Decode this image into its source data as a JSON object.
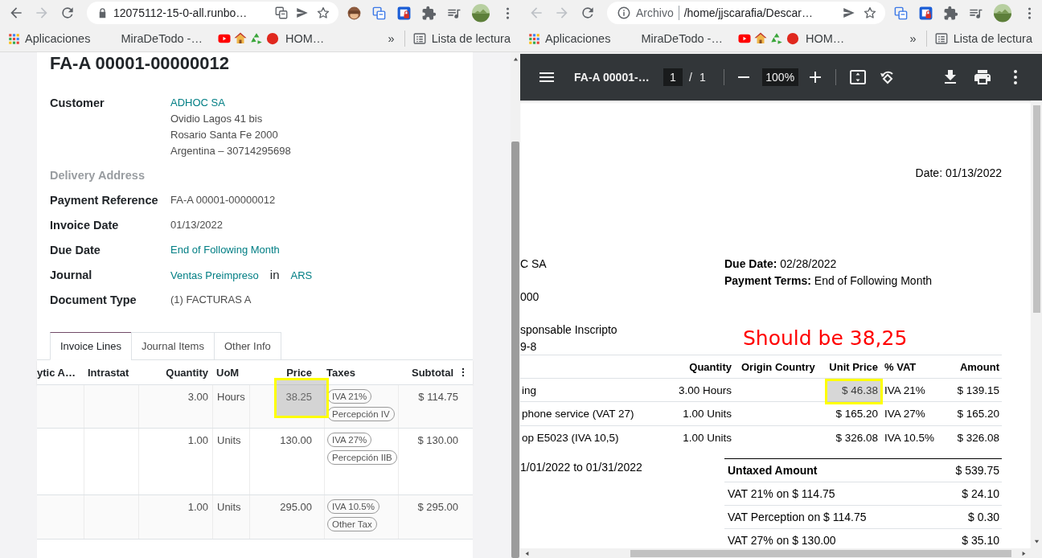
{
  "left_window": {
    "nav": [
      {
        "kind": "back",
        "disabled": false
      },
      {
        "kind": "forward",
        "disabled": true
      },
      {
        "kind": "reload",
        "disabled": false
      }
    ],
    "address": {
      "kind": "secure",
      "url": "12075112-15-0-all.runbo…"
    },
    "address_actions": [
      {
        "kind": "translate"
      },
      {
        "kind": "send"
      },
      {
        "kind": "star"
      }
    ],
    "extensions": [
      {
        "kind": "monkey"
      },
      {
        "kind": "translate"
      },
      {
        "kind": "lock-badge"
      },
      {
        "kind": "puzzle"
      },
      {
        "kind": "media"
      },
      {
        "kind": "avatar"
      },
      {
        "kind": "menu"
      }
    ],
    "bookmarks": [
      {
        "kind": "apps",
        "label": "Aplicaciones"
      },
      {
        "kind": "plain",
        "label": "MiraDeTodo -…"
      },
      {
        "kind": "video"
      },
      {
        "kind": "home",
        "label": "HOM…"
      },
      {
        "kind": "more",
        "label": "»"
      },
      {
        "kind": "reading-list",
        "label": "Lista de lectura"
      }
    ]
  },
  "invoice": {
    "title": "FA-A 00001-00000012",
    "fields": [
      {
        "label": "Customer",
        "muted": false,
        "lines": [
          [
            {
              "text": "ADHOC SA",
              "kind": "link"
            }
          ],
          [
            {
              "text": "Ovidio Lagos 41 bis",
              "kind": "text"
            }
          ],
          [
            {
              "text": "Rosario Santa Fe 2000",
              "kind": "text"
            }
          ],
          [
            {
              "text": "Argentina – 30714295698",
              "kind": "text"
            }
          ]
        ]
      },
      {
        "label": "Delivery Address",
        "muted": true
      },
      {
        "label": "Payment Reference",
        "muted": false,
        "lines": [
          [
            {
              "text": "FA-A 00001-00000012",
              "kind": "text"
            }
          ]
        ]
      },
      {
        "label": "Invoice Date",
        "muted": false,
        "lines": [
          [
            {
              "text": "01/13/2022",
              "kind": "text"
            }
          ]
        ]
      },
      {
        "label": "Due Date",
        "muted": false,
        "lines": [
          [
            {
              "text": "End of Following Month",
              "kind": "link"
            }
          ]
        ]
      },
      {
        "label": "Journal",
        "muted": false,
        "lines": [
          [
            {
              "text": "Ventas Preimpreso",
              "kind": "link"
            },
            {
              "text": "in",
              "kind": "plain"
            },
            {
              "text": "ARS",
              "kind": "link"
            }
          ]
        ]
      },
      {
        "label": "Document Type",
        "muted": false,
        "lines": [
          [
            {
              "text": "(1) FACTURAS A",
              "kind": "text"
            }
          ]
        ]
      }
    ],
    "tabs": [
      {
        "label": "Invoice Lines",
        "selected": true
      },
      {
        "label": "Journal Items",
        "selected": false
      },
      {
        "label": "Other Info",
        "selected": false
      }
    ],
    "table": {
      "columns": [
        "ytic A…",
        "Intrastat",
        "Quantity",
        "UoM",
        "Price",
        "Taxes",
        "Subtotal"
      ],
      "rows": [
        {
          "quantity": "3.00",
          "uom": "Hours",
          "price": "38.25",
          "taxes": [
            "IVA 21%",
            "Percepción IV"
          ],
          "subtotal": "$ 114.75"
        },
        {
          "quantity": "1.00",
          "uom": "Units",
          "price": "130.00",
          "taxes": [
            "IVA 27%",
            "Percepción IIB"
          ],
          "subtotal": "$ 130.00"
        },
        {
          "quantity": "1.00",
          "uom": "Units",
          "price": "295.00",
          "taxes": [
            "IVA 10.5%",
            "Other Tax"
          ],
          "subtotal": "$ 295.00"
        }
      ]
    }
  },
  "right_window": {
    "nav": [
      {
        "kind": "back",
        "disabled": true
      },
      {
        "kind": "forward",
        "disabled": true
      },
      {
        "kind": "reload",
        "disabled": false
      }
    ],
    "address": {
      "kind": "file",
      "label": "Archivo",
      "url": "/home/jjscarafia/Descar…"
    },
    "address_actions": [
      {
        "kind": "send"
      },
      {
        "kind": "star"
      }
    ],
    "extensions": [
      {
        "kind": "translate"
      },
      {
        "kind": "lock-badge"
      },
      {
        "kind": "puzzle"
      },
      {
        "kind": "media"
      },
      {
        "kind": "avatar"
      },
      {
        "kind": "menu"
      }
    ],
    "bookmarks": [
      {
        "kind": "apps",
        "label": "Aplicaciones"
      },
      {
        "kind": "plain",
        "label": "MiraDeTodo -…"
      },
      {
        "kind": "video"
      },
      {
        "kind": "home",
        "label": "HOM…"
      },
      {
        "kind": "more",
        "label": "»"
      },
      {
        "kind": "reading-list",
        "label": "Lista de lectura"
      }
    ]
  },
  "pdf_viewer": {
    "title": "FA-A 00001-…",
    "page": "1",
    "separator": "/",
    "page_count": "1",
    "zoom": "100%",
    "document": {
      "date": "Date: 01/13/2022",
      "partner_lines": [
        "C SA",
        "000",
        "sponsable Inscripto",
        "9-8"
      ],
      "terms": [
        {
          "label": "Due Date:",
          "value": "02/28/2022"
        },
        {
          "label": "Payment Terms:",
          "value": "End of Following Month"
        }
      ],
      "table": {
        "columns": [
          "Quantity",
          "Origin Country",
          "Unit Price",
          "% VAT",
          "Amount"
        ],
        "rows": [
          {
            "description": "ing",
            "quantity": "3.00 Hours",
            "unit_price": "$ 46.38",
            "vat": "IVA 21%",
            "amount": "$ 139.15"
          },
          {
            "description": "phone service (VAT 27)",
            "quantity": "1.00 Units",
            "unit_price": "$ 165.20",
            "vat": "IVA 27%",
            "amount": "$ 165.20"
          },
          {
            "description": "op E5023 (IVA 10,5)",
            "quantity": "1.00 Units",
            "unit_price": "$ 326.08",
            "vat": "IVA 10.5%",
            "amount": "$ 326.08"
          }
        ]
      },
      "period": "1/01/2022 to 01/31/2022",
      "totals": [
        {
          "label": "Untaxed Amount",
          "value": "$ 539.75",
          "bold": true
        },
        {
          "label": "VAT 21% on $ 114.75",
          "value": "$ 24.10",
          "bold": false
        },
        {
          "label": "VAT Perception on $ 114.75",
          "value": "$ 0.30",
          "bold": false
        },
        {
          "label": "VAT 27% on $ 130.00",
          "value": "$ 35.10",
          "bold": false
        }
      ]
    }
  },
  "annotations": [
    {
      "kind": "highlight"
    },
    {
      "kind": "highlight"
    },
    {
      "kind": "note",
      "text": "Should be 38,25"
    }
  ]
}
